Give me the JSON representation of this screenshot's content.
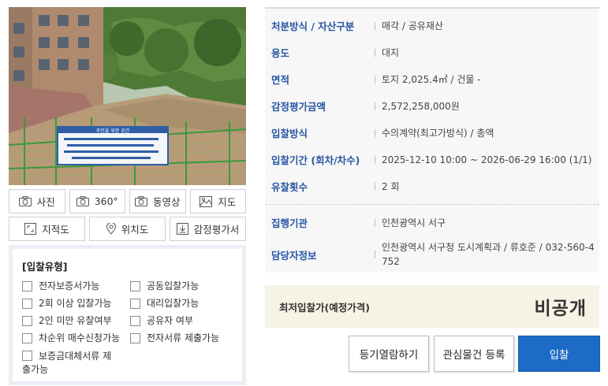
{
  "toolbar": {
    "photo": {
      "label": "사진",
      "icon": "camera-icon"
    },
    "view360": {
      "label": "360°",
      "icon": "camera-icon"
    },
    "video": {
      "label": "동영상",
      "icon": "camera-icon"
    },
    "map": {
      "label": "지도",
      "icon": "image-map-icon"
    },
    "cadastral": {
      "label": "지적도",
      "icon": "expand-map-icon"
    },
    "location": {
      "label": "위치도",
      "icon": "location-pin-icon"
    },
    "appraisal": {
      "label": "감정평가서",
      "icon": "download-icon"
    }
  },
  "bid_type": {
    "title": "[입찰유형]",
    "options": [
      {
        "label": "전자보증서가능",
        "checked": false
      },
      {
        "label": "공동입찰가능",
        "checked": false
      },
      {
        "label": "2회 이상 입찰가능",
        "checked": false
      },
      {
        "label": "대리입찰가능",
        "checked": false
      },
      {
        "label": "2인 미만 유찰여부",
        "checked": false
      },
      {
        "label": "공유자 여부",
        "checked": false
      },
      {
        "label": "차순위 매수신청가능",
        "checked": false
      },
      {
        "label": "전자서류 제출가능",
        "checked": false
      },
      {
        "label": "보증금대체서류 제출가능",
        "checked": false
      }
    ]
  },
  "details": {
    "disposal": {
      "label": "처분방식 / 자산구분",
      "value": "매각 / 공유재산"
    },
    "usage": {
      "label": "용도",
      "value": "대지"
    },
    "area": {
      "label": "면적",
      "value": "토지 2,025.4㎡ / 건물 -"
    },
    "appraised": {
      "label": "감정평가금액",
      "value": "2,572,258,000원"
    },
    "bid_method": {
      "label": "입찰방식",
      "value": "수의계약(최고가방식) / 총액"
    },
    "bid_period": {
      "label": "입찰기간 (회차/차수)",
      "value": "2025-12-10 10:00 ~ 2026-06-29 16:00 (1/1)"
    },
    "failed_count": {
      "label": "유찰횟수",
      "value": "2 회"
    },
    "agency": {
      "label": "집행기관",
      "value": "인천광역시 서구"
    },
    "contact": {
      "label": "담당자정보",
      "value": "인천광역시 서구청 도시계획과 / 류호준 / 032-560-4752"
    }
  },
  "price": {
    "label": "최저입찰가(예정가격)",
    "value": "비공개"
  },
  "actions": {
    "registry": "등기열람하기",
    "watch": "관심물건 등록",
    "bid": "입찰"
  },
  "photo_banner": {
    "text": "주민을 위한 공간"
  },
  "colors": {
    "label_blue": "#2855a3",
    "bid_button": "#1d6bc6",
    "price_bg": "#f6f2e4",
    "info_bg": "#f7f7f7"
  }
}
